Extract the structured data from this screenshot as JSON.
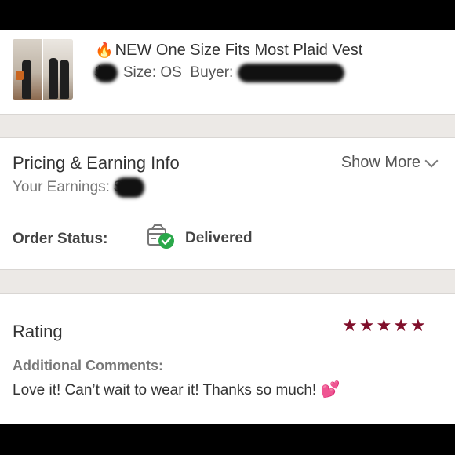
{
  "order": {
    "emoji": "🔥",
    "title": "NEW One Size Fits Most Plaid Vest",
    "price_label": "$",
    "size_label": "Size: OS",
    "buyer_label": "Buyer:"
  },
  "pricing": {
    "title": "Pricing & Earning Info",
    "earnings_label": "Your Earnings:",
    "earnings_prefix": "$",
    "show_more": "Show More",
    "show_more_icon": "chevron-down-icon"
  },
  "status": {
    "label": "Order Status:",
    "value": "Delivered",
    "icon": "package-delivered-icon",
    "check_color": "#2aa84a"
  },
  "rating": {
    "title": "Rating",
    "stars": 5,
    "star_color": "#7f0e2a",
    "comments_label": "Additional Comments:",
    "comment_text": "Love it! Can’t wait to wear it! Thanks so much!",
    "emoji": "💕"
  }
}
